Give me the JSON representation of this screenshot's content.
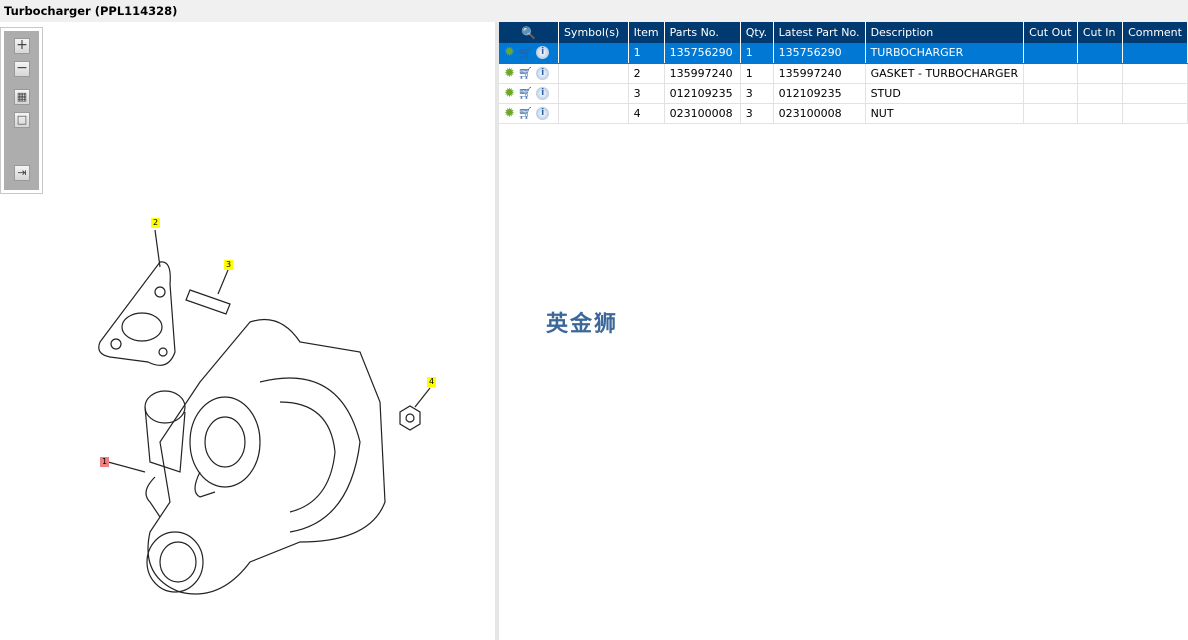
{
  "title": "Turbocharger (PPL114328)",
  "toolbar": {
    "zoom_in": "+",
    "zoom_out": "−",
    "fit": "▦",
    "reset": "□",
    "export": "⇥"
  },
  "diagram": {
    "callouts": [
      "1",
      "2",
      "3",
      "4"
    ]
  },
  "table": {
    "headers": [
      "Symbol(s)",
      "Item",
      "Parts No.",
      "Qty.",
      "Latest Part No.",
      "Description",
      "Cut Out",
      "Cut In",
      "Comment"
    ],
    "rows": [
      {
        "item": "1",
        "part": "135756290",
        "qty": "1",
        "latest": "135756290",
        "desc": "TURBOCHARGER"
      },
      {
        "item": "2",
        "part": "135997240",
        "qty": "1",
        "latest": "135997240",
        "desc": "GASKET - TURBOCHARGER"
      },
      {
        "item": "3",
        "part": "012109235",
        "qty": "3",
        "latest": "012109235",
        "desc": "STUD"
      },
      {
        "item": "4",
        "part": "023100008",
        "qty": "3",
        "latest": "023100008",
        "desc": "NUT"
      }
    ]
  },
  "watermark": "英金狮",
  "colors": {
    "header": "#003a70",
    "selected": "#0078d4"
  }
}
